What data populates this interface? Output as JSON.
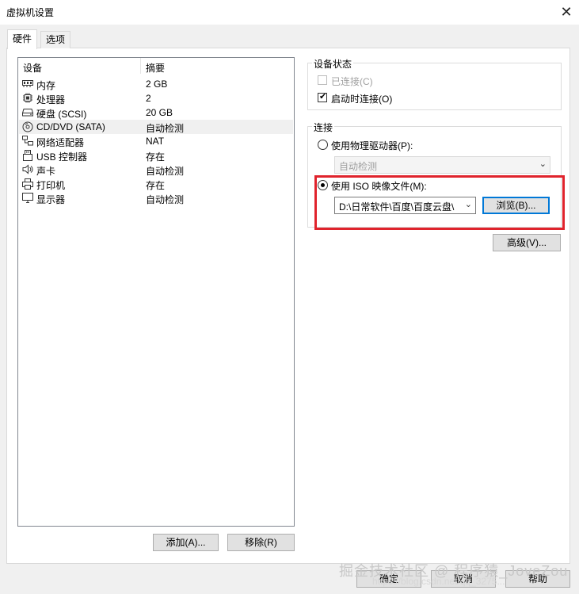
{
  "window": {
    "title": "虚拟机设置"
  },
  "tabs": [
    {
      "label": "硬件",
      "active": true
    },
    {
      "label": "选项",
      "active": false
    }
  ],
  "device_list": {
    "columns": [
      "设备",
      "摘要"
    ],
    "items": [
      {
        "name": "内存",
        "summary": "2 GB",
        "icon": "memory-icon"
      },
      {
        "name": "处理器",
        "summary": "2",
        "icon": "processor-icon"
      },
      {
        "name": "硬盘 (SCSI)",
        "summary": "20 GB",
        "icon": "hard-disk-icon"
      },
      {
        "name": "CD/DVD (SATA)",
        "summary": "自动检测",
        "icon": "cd-dvd-icon",
        "selected": true
      },
      {
        "name": "网络适配器",
        "summary": "NAT",
        "icon": "network-adapter-icon"
      },
      {
        "name": "USB 控制器",
        "summary": "存在",
        "icon": "usb-icon"
      },
      {
        "name": "声卡",
        "summary": "自动检测",
        "icon": "speaker-icon"
      },
      {
        "name": "打印机",
        "summary": "存在",
        "icon": "printer-icon"
      },
      {
        "name": "显示器",
        "summary": "自动检测",
        "icon": "monitor-icon"
      }
    ],
    "add_label": "添加(A)...",
    "remove_label": "移除(R)"
  },
  "device_status": {
    "legend": "设备状态",
    "connected_label": "已连接(C)",
    "connected_checked": false,
    "connect_at_power_on_label": "启动时连接(O)",
    "connect_at_power_on_checked": true
  },
  "connection": {
    "legend": "连接",
    "physical_drive_label": "使用物理驱动器(P):",
    "physical_drive_value": "自动检测",
    "iso_label": "使用 ISO 映像文件(M):",
    "iso_path": "D:\\日常软件\\百度\\百度云盘\\",
    "browse_label": "浏览(B)...",
    "selected": "iso"
  },
  "advanced_label": "高级(V)...",
  "footer": {
    "ok_label": "确定",
    "cancel_label": "取消",
    "help_label": "帮助"
  },
  "watermark": {
    "text": "掘金技术社区 @ 程序猿_JoveZou",
    "url_text": "https://blog.csdn.net/qq_3275..."
  }
}
